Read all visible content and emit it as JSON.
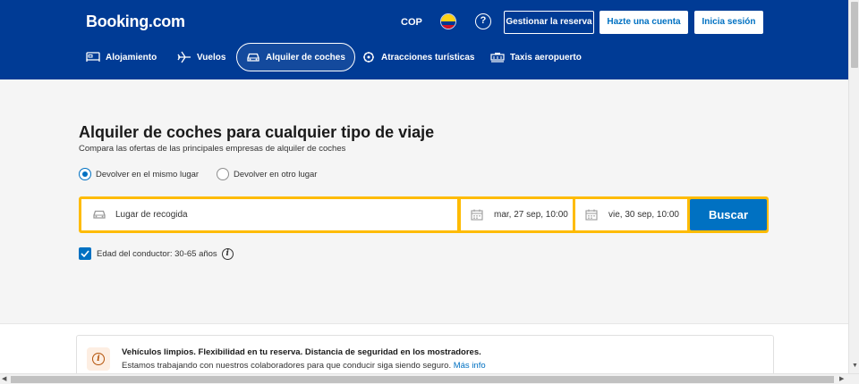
{
  "header": {
    "logo": "Booking.com",
    "currency": "COP",
    "help": "?",
    "manage_booking": "Gestionar la reserva",
    "register": "Hazte una cuenta",
    "signin": "Inicia sesión"
  },
  "nav": {
    "items": [
      {
        "label": "Alojamiento",
        "icon": "bed-icon"
      },
      {
        "label": "Vuelos",
        "icon": "plane-icon"
      },
      {
        "label": "Alquiler de coches",
        "icon": "car-icon",
        "active": true
      },
      {
        "label": "Atracciones turísticas",
        "icon": "attractions-icon"
      },
      {
        "label": "Taxis aeropuerto",
        "icon": "taxi-icon"
      }
    ]
  },
  "main": {
    "title": "Alquiler de coches para cualquier tipo de viaje",
    "subtitle": "Compara las ofertas de las principales empresas de alquiler de coches",
    "return_same": "Devolver en el mismo lugar",
    "return_other": "Devolver en otro lugar",
    "pickup_placeholder": "Lugar de recogida",
    "pickup_date": "mar, 27 sep, 10:00",
    "dropoff_date": "vie, 30 sep, 10:00",
    "search": "Buscar",
    "driver_age": "Edad del conductor: 30-65 años",
    "info_glyph": "i"
  },
  "notice": {
    "heading": "Vehículos limpios. Flexibilidad en tu reserva. Distancia de seguridad en los mostradores.",
    "body": "Estamos trabajando con nuestros colaboradores para que conducir siga siendo seguro.",
    "link": "Más info"
  },
  "colors": {
    "brand_blue": "#003b95",
    "accent_yellow": "#febb02",
    "action_blue": "#0071c2"
  }
}
